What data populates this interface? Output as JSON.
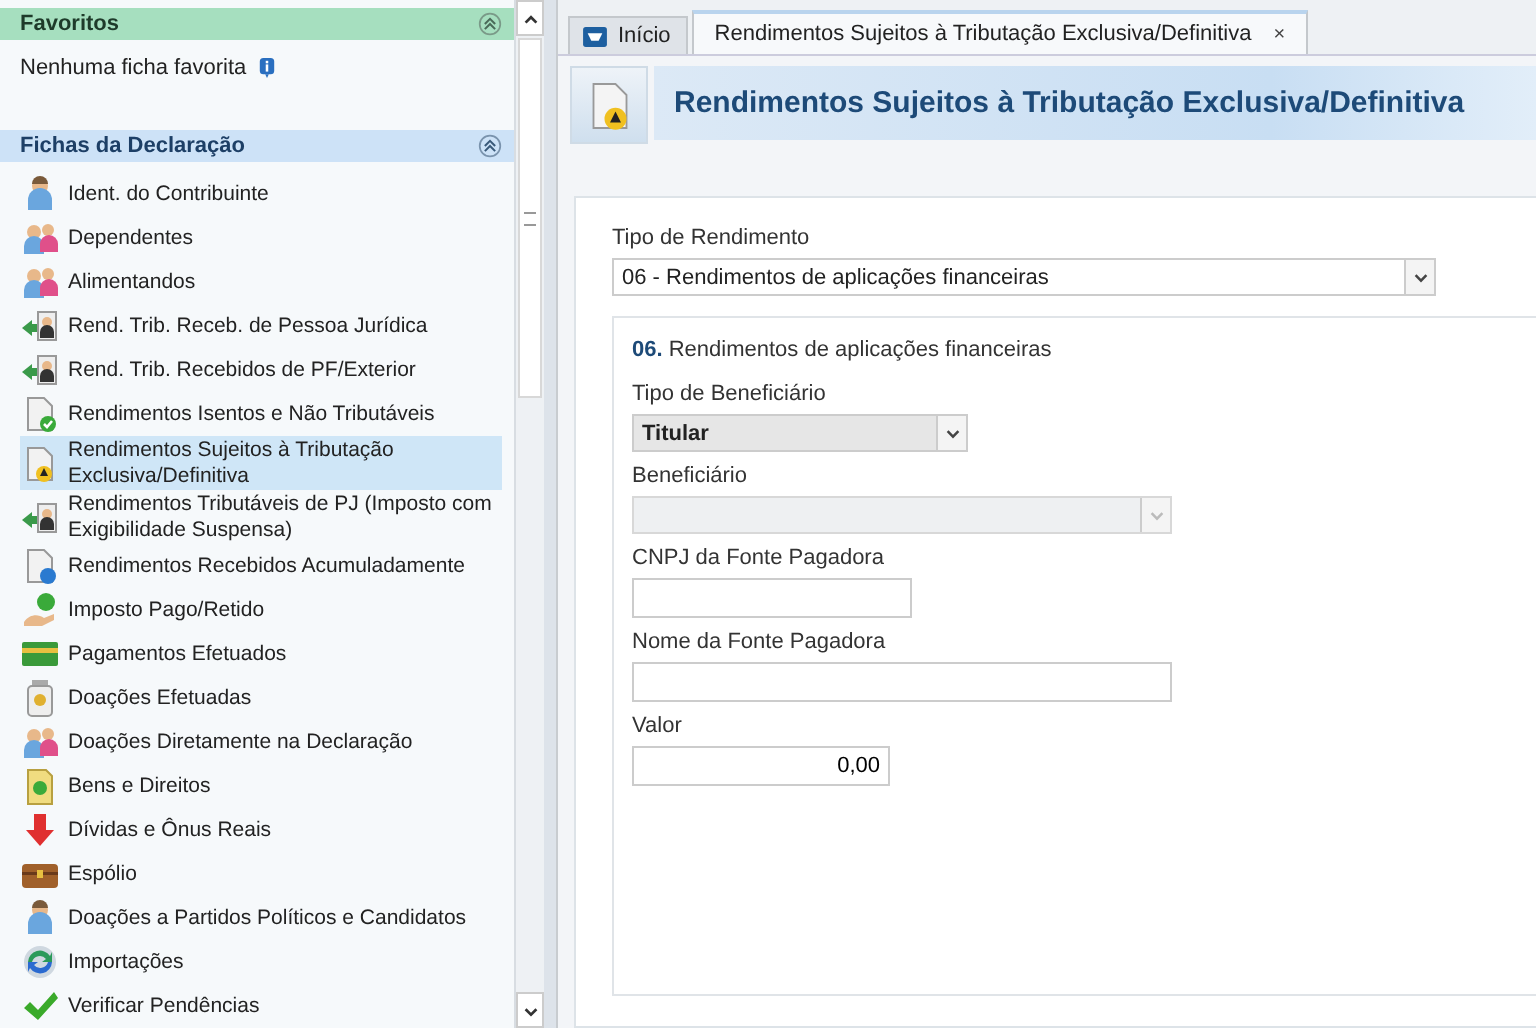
{
  "sidebar": {
    "favorites": {
      "title": "Favoritos",
      "expanded": true,
      "empty_text": "Nenhuma ficha favorita"
    },
    "section": {
      "title": "Fichas da Declaração",
      "expanded": true
    },
    "items": [
      {
        "label": "Ident. do Contribuinte",
        "selected": false
      },
      {
        "label": "Dependentes",
        "selected": false
      },
      {
        "label": "Alimentandos",
        "selected": false
      },
      {
        "label": "Rend. Trib. Receb. de Pessoa Jurídica",
        "selected": false
      },
      {
        "label": "Rend. Trib. Recebidos de PF/Exterior",
        "selected": false
      },
      {
        "label": "Rendimentos Isentos e Não Tributáveis",
        "selected": false
      },
      {
        "label": "Rendimentos Sujeitos à Tributação Exclusiva/Definitiva",
        "selected": true
      },
      {
        "label": "Rendimentos Tributáveis de PJ (Imposto com Exigibilidade Suspensa)",
        "selected": false
      },
      {
        "label": "Rendimentos Recebidos Acumuladamente",
        "selected": false
      },
      {
        "label": "Imposto Pago/Retido",
        "selected": false
      },
      {
        "label": "Pagamentos Efetuados",
        "selected": false
      },
      {
        "label": "Doações Efetuadas",
        "selected": false
      },
      {
        "label": "Doações Diretamente na Declaração",
        "selected": false
      },
      {
        "label": "Bens e Direitos",
        "selected": false
      },
      {
        "label": "Dívidas e Ônus Reais",
        "selected": false
      },
      {
        "label": "Espólio",
        "selected": false
      },
      {
        "label": "Doações a Partidos Políticos e Candidatos",
        "selected": false
      },
      {
        "label": "Importações",
        "selected": false
      },
      {
        "label": "Verificar Pendências",
        "selected": false
      }
    ]
  },
  "tabs": [
    {
      "label": "Início",
      "selected": false
    },
    {
      "label": "Rendimentos Sujeitos à Tributação Exclusiva/Definitiva",
      "selected": true,
      "close": "×"
    }
  ],
  "page_title": "Rendimentos Sujeitos à Tributação Exclusiva/Definitiva",
  "form": {
    "type_label": "Tipo de Rendimento",
    "type_value": "06 - Rendimentos de aplicações financeiras",
    "section_title": "**06.** Rendimentos de aplicações financeiras",
    "fields": [
      {
        "label": "Tipo de Beneficiário",
        "kind": "select",
        "value": "Titular",
        "disabled": false
      },
      {
        "label": "Beneficiário",
        "kind": "select",
        "disabled": true
      },
      {
        "label": "CNPJ da Fonte Pagadora",
        "kind": "text"
      },
      {
        "label": "Nome da Fonte Pagadora",
        "kind": "text"
      },
      {
        "label": "Valor",
        "kind": "amount",
        "value": "0,00"
      }
    ]
  }
}
